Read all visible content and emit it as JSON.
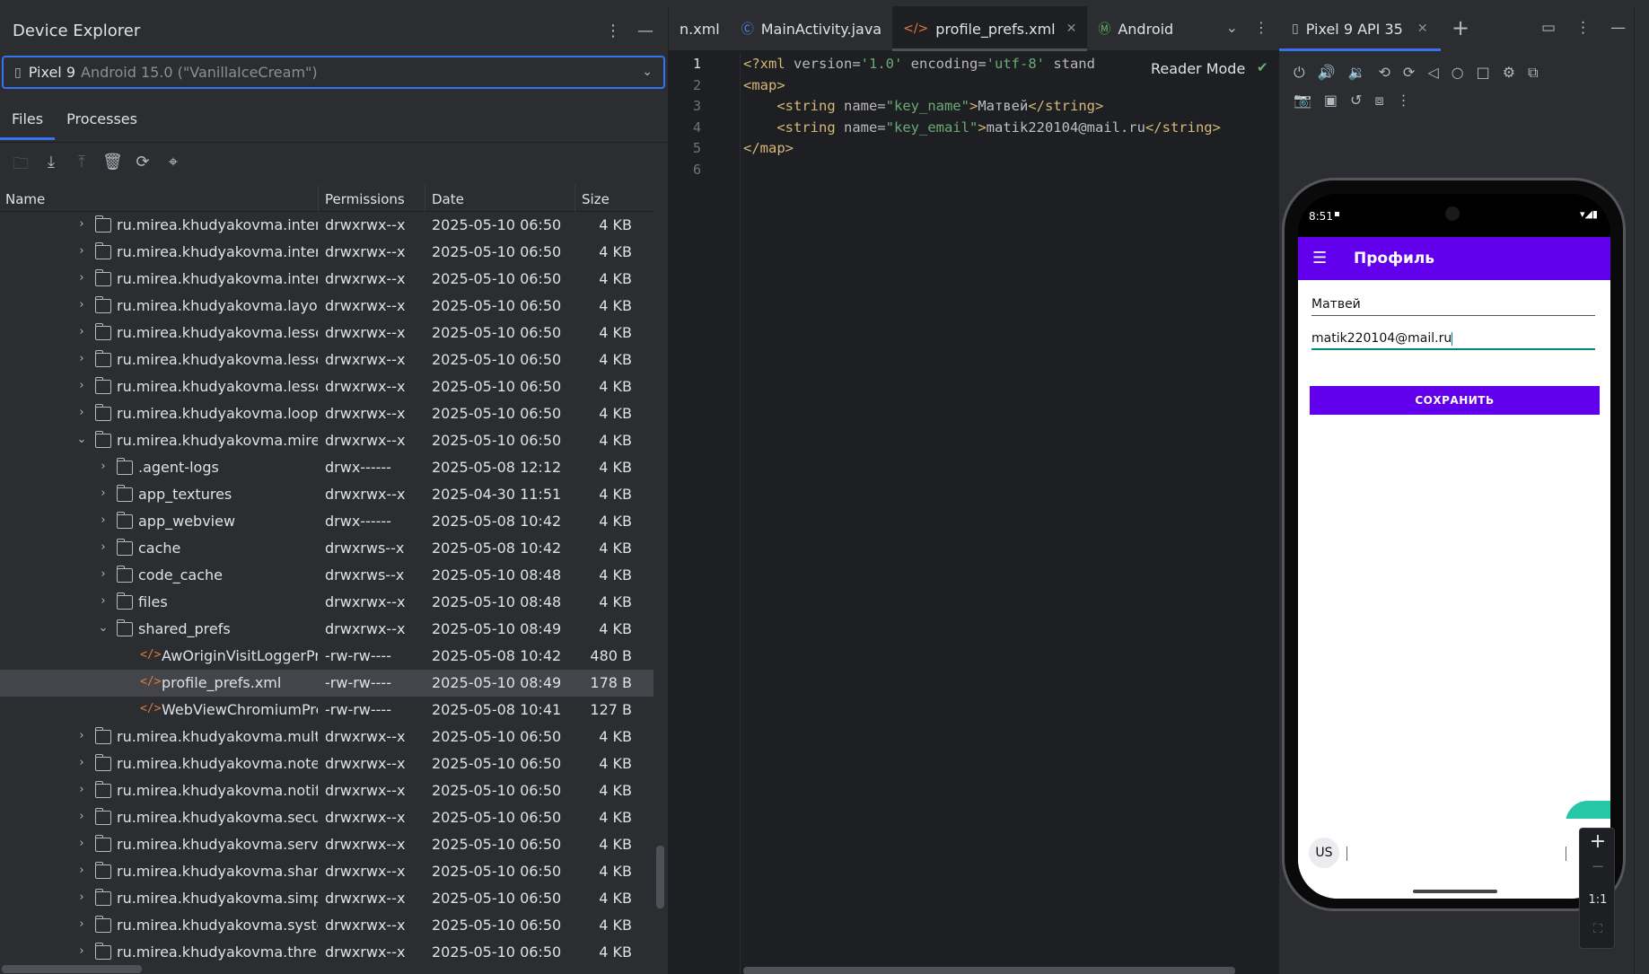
{
  "device_explorer": {
    "title": "Device Explorer",
    "device": {
      "name": "Pixel 9",
      "version": "Android 15.0 (\"VanillaIceCream\")"
    },
    "tabs": [
      "Files",
      "Processes"
    ],
    "columns": {
      "name": "Name",
      "permissions": "Permissions",
      "date": "Date",
      "size": "Size"
    },
    "rows": [
      {
        "name": "ru.mirea.khudyakovma.intenta",
        "perm": "drwxrwx--x",
        "date": "2025-05-10 06:50",
        "size": "4 KB",
        "depth": 0,
        "type": "folder",
        "expanded": false
      },
      {
        "name": "ru.mirea.khudyakovma.intentf",
        "perm": "drwxrwx--x",
        "date": "2025-05-10 06:50",
        "size": "4 KB",
        "depth": 0,
        "type": "folder",
        "expanded": false
      },
      {
        "name": "ru.mirea.khudyakovma.interna",
        "perm": "drwxrwx--x",
        "date": "2025-05-10 06:50",
        "size": "4 KB",
        "depth": 0,
        "type": "folder",
        "expanded": false
      },
      {
        "name": "ru.mirea.khudyakovma.layout",
        "perm": "drwxrwx--x",
        "date": "2025-05-10 06:50",
        "size": "4 KB",
        "depth": 0,
        "type": "folder",
        "expanded": false
      },
      {
        "name": "ru.mirea.khudyakovma.lesson",
        "perm": "drwxrwx--x",
        "date": "2025-05-10 06:50",
        "size": "4 KB",
        "depth": 0,
        "type": "folder",
        "expanded": false
      },
      {
        "name": "ru.mirea.khudyakovma.lesson",
        "perm": "drwxrwx--x",
        "date": "2025-05-10 06:50",
        "size": "4 KB",
        "depth": 0,
        "type": "folder",
        "expanded": false
      },
      {
        "name": "ru.mirea.khudyakovma.lesson",
        "perm": "drwxrwx--x",
        "date": "2025-05-10 06:50",
        "size": "4 KB",
        "depth": 0,
        "type": "folder",
        "expanded": false
      },
      {
        "name": "ru.mirea.khudyakovma.looper",
        "perm": "drwxrwx--x",
        "date": "2025-05-10 06:50",
        "size": "4 KB",
        "depth": 0,
        "type": "folder",
        "expanded": false
      },
      {
        "name": "ru.mirea.khudyakovma.mireap",
        "perm": "drwxrwx--x",
        "date": "2025-05-10 06:50",
        "size": "4 KB",
        "depth": 0,
        "type": "folder",
        "expanded": true
      },
      {
        "name": ".agent-logs",
        "perm": "drwx------",
        "date": "2025-05-08 12:12",
        "size": "4 KB",
        "depth": 1,
        "type": "folder",
        "expanded": false
      },
      {
        "name": "app_textures",
        "perm": "drwxrwx--x",
        "date": "2025-04-30 11:51",
        "size": "4 KB",
        "depth": 1,
        "type": "folder",
        "expanded": false
      },
      {
        "name": "app_webview",
        "perm": "drwx------",
        "date": "2025-05-08 10:42",
        "size": "4 KB",
        "depth": 1,
        "type": "folder",
        "expanded": false
      },
      {
        "name": "cache",
        "perm": "drwxrws--x",
        "date": "2025-05-08 10:42",
        "size": "4 KB",
        "depth": 1,
        "type": "folder",
        "expanded": false
      },
      {
        "name": "code_cache",
        "perm": "drwxrws--x",
        "date": "2025-05-10 08:48",
        "size": "4 KB",
        "depth": 1,
        "type": "folder",
        "expanded": false
      },
      {
        "name": "files",
        "perm": "drwxrwx--x",
        "date": "2025-05-10 08:48",
        "size": "4 KB",
        "depth": 1,
        "type": "folder",
        "expanded": false
      },
      {
        "name": "shared_prefs",
        "perm": "drwxrwx--x",
        "date": "2025-05-10 08:49",
        "size": "4 KB",
        "depth": 1,
        "type": "folder",
        "expanded": true
      },
      {
        "name": "AwOriginVisitLoggerPre",
        "perm": "-rw-rw----",
        "date": "2025-05-08 10:42",
        "size": "480 B",
        "depth": 2,
        "type": "xml"
      },
      {
        "name": "profile_prefs.xml",
        "perm": "-rw-rw----",
        "date": "2025-05-10 08:49",
        "size": "178 B",
        "depth": 2,
        "type": "xml",
        "selected": true
      },
      {
        "name": "WebViewChromiumPref",
        "perm": "-rw-rw----",
        "date": "2025-05-08 10:41",
        "size": "127 B",
        "depth": 2,
        "type": "xml"
      },
      {
        "name": "ru.mirea.khudyakovma.multia",
        "perm": "drwxrwx--x",
        "date": "2025-05-10 06:50",
        "size": "4 KB",
        "depth": 0,
        "type": "folder",
        "expanded": false
      },
      {
        "name": "ru.mirea.khudyakovma.notebo",
        "perm": "drwxrwx--x",
        "date": "2025-05-10 06:50",
        "size": "4 KB",
        "depth": 0,
        "type": "folder",
        "expanded": false
      },
      {
        "name": "ru.mirea.khudyakovma.notific",
        "perm": "drwxrwx--x",
        "date": "2025-05-10 06:50",
        "size": "4 KB",
        "depth": 0,
        "type": "folder",
        "expanded": false
      },
      {
        "name": "ru.mirea.khudyakovma.secure",
        "perm": "drwxrwx--x",
        "date": "2025-05-10 06:50",
        "size": "4 KB",
        "depth": 0,
        "type": "folder",
        "expanded": false
      },
      {
        "name": "ru.mirea.khudyakovma.servic",
        "perm": "drwxrwx--x",
        "date": "2025-05-10 06:50",
        "size": "4 KB",
        "depth": 0,
        "type": "folder",
        "expanded": false
      },
      {
        "name": "ru.mirea.khudyakovma.sharer",
        "perm": "drwxrwx--x",
        "date": "2025-05-10 06:50",
        "size": "4 KB",
        "depth": 0,
        "type": "folder",
        "expanded": false
      },
      {
        "name": "ru.mirea.khudyakovma.simple",
        "perm": "drwxrwx--x",
        "date": "2025-05-10 06:50",
        "size": "4 KB",
        "depth": 0,
        "type": "folder",
        "expanded": false
      },
      {
        "name": "ru.mirea.khudyakovma.systen",
        "perm": "drwxrwx--x",
        "date": "2025-05-10 06:50",
        "size": "4 KB",
        "depth": 0,
        "type": "folder",
        "expanded": false
      },
      {
        "name": "ru.mirea.khudyakovma.thread",
        "perm": "drwxrwx--x",
        "date": "2025-05-10 06:50",
        "size": "4 KB",
        "depth": 0,
        "type": "folder",
        "expanded": false
      }
    ]
  },
  "editor": {
    "tabs": [
      {
        "label": "n.xml",
        "icon": "",
        "active": false
      },
      {
        "label": "MainActivity.java",
        "icon": "java-class-icon",
        "active": false
      },
      {
        "label": "profile_prefs.xml",
        "icon": "xml-file-icon",
        "active": true
      },
      {
        "label": "Android",
        "icon": "manifest-icon",
        "active": false
      }
    ],
    "reader_mode": "Reader Mode",
    "lines": [
      {
        "n": "1",
        "parts": [
          [
            "tg",
            "<?xml "
          ],
          [
            "at",
            "version="
          ],
          [
            "av",
            "'1.0'"
          ],
          [
            "at",
            " encoding="
          ],
          [
            "av",
            "'utf-8'"
          ],
          [
            "at",
            " stand"
          ]
        ]
      },
      {
        "n": "2",
        "parts": [
          [
            "tg",
            "<map>"
          ]
        ]
      },
      {
        "n": "3",
        "parts": [
          [
            "tx",
            "    "
          ],
          [
            "tg",
            "<string "
          ],
          [
            "at",
            "name="
          ],
          [
            "av",
            "\"key_name\""
          ],
          [
            "tg",
            ">"
          ],
          [
            "tx",
            "Матвей"
          ],
          [
            "tg",
            "</string>"
          ]
        ]
      },
      {
        "n": "4",
        "parts": [
          [
            "tx",
            "    "
          ],
          [
            "tg",
            "<string "
          ],
          [
            "at",
            "name="
          ],
          [
            "av",
            "\"key_email\""
          ],
          [
            "tg",
            ">"
          ],
          [
            "tx",
            "matik220104@mail.ru"
          ],
          [
            "tg",
            "</string>"
          ]
        ]
      },
      {
        "n": "5",
        "parts": [
          [
            "tg",
            "</map>"
          ]
        ]
      },
      {
        "n": "6",
        "parts": []
      }
    ]
  },
  "emulator": {
    "tab_label": "Pixel 9 API 35",
    "phone": {
      "time": "8:51",
      "app_title": "Профиль",
      "name_value": "Матвей",
      "email_value": "matik220104@mail.ru",
      "save_label": "СОХРАНИТЬ",
      "keyboard_lang": "US"
    },
    "zoom": {
      "plus": "+",
      "minus": "−",
      "ratio": "1:1"
    }
  },
  "colors": {
    "accent": "#3574f0",
    "app_primary": "#6200ee",
    "xml_tag": "#d5b778",
    "xml_value": "#6aab73"
  }
}
